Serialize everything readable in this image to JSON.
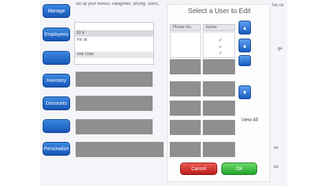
{
  "nav": {
    "items": [
      "Manage",
      "Employees",
      "",
      "Inventory",
      "Discounts",
      "",
      "Personalize"
    ]
  },
  "background": {
    "instruction_text": "set up your menus, categories, pricing, users,",
    "list_rows": [
      "Er k",
      "Inc al",
      "",
      "one User"
    ],
    "right_labels": [
      "fun ce",
      "ge",
      "",
      "ne",
      "nd"
    ]
  },
  "dialog": {
    "title": "Select a User to Edit",
    "columns": {
      "phone": "Phone No.",
      "active": "Active"
    },
    "phone_values": [
      "",
      "",
      "",
      ""
    ],
    "active_checks": [
      "",
      "✓",
      "✓",
      "✓"
    ],
    "view_all": "View All",
    "cancel": "Cancel",
    "ok": "OK"
  },
  "icons": {
    "scroll_up": "triangle-up",
    "scroll_down": "triangle-down"
  },
  "colors": {
    "nav_blue": "#2a6fd0",
    "cancel_red": "#d9352f",
    "ok_green": "#3cbc3f"
  }
}
